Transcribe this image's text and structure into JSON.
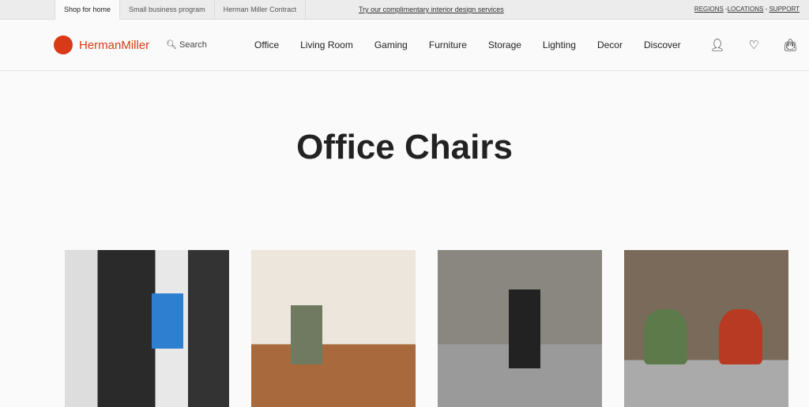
{
  "topbar": {
    "tabs": [
      "Shop for home",
      "Small business program",
      "Herman Miller Contract"
    ],
    "promo": "Try our complimentary interior design services",
    "links": [
      "REGIONS",
      "LOCATIONS",
      "SUPPORT"
    ]
  },
  "header": {
    "brand": "HermanMiller",
    "search_label": "Search",
    "nav": [
      "Office",
      "Living Room",
      "Gaming",
      "Furniture",
      "Storage",
      "Lighting",
      "Decor",
      "Discover"
    ],
    "icons": [
      "account-icon",
      "heart-icon",
      "bag-icon"
    ]
  },
  "main": {
    "title": "Office Chairs"
  },
  "colors": {
    "brand": "#d83a18"
  }
}
